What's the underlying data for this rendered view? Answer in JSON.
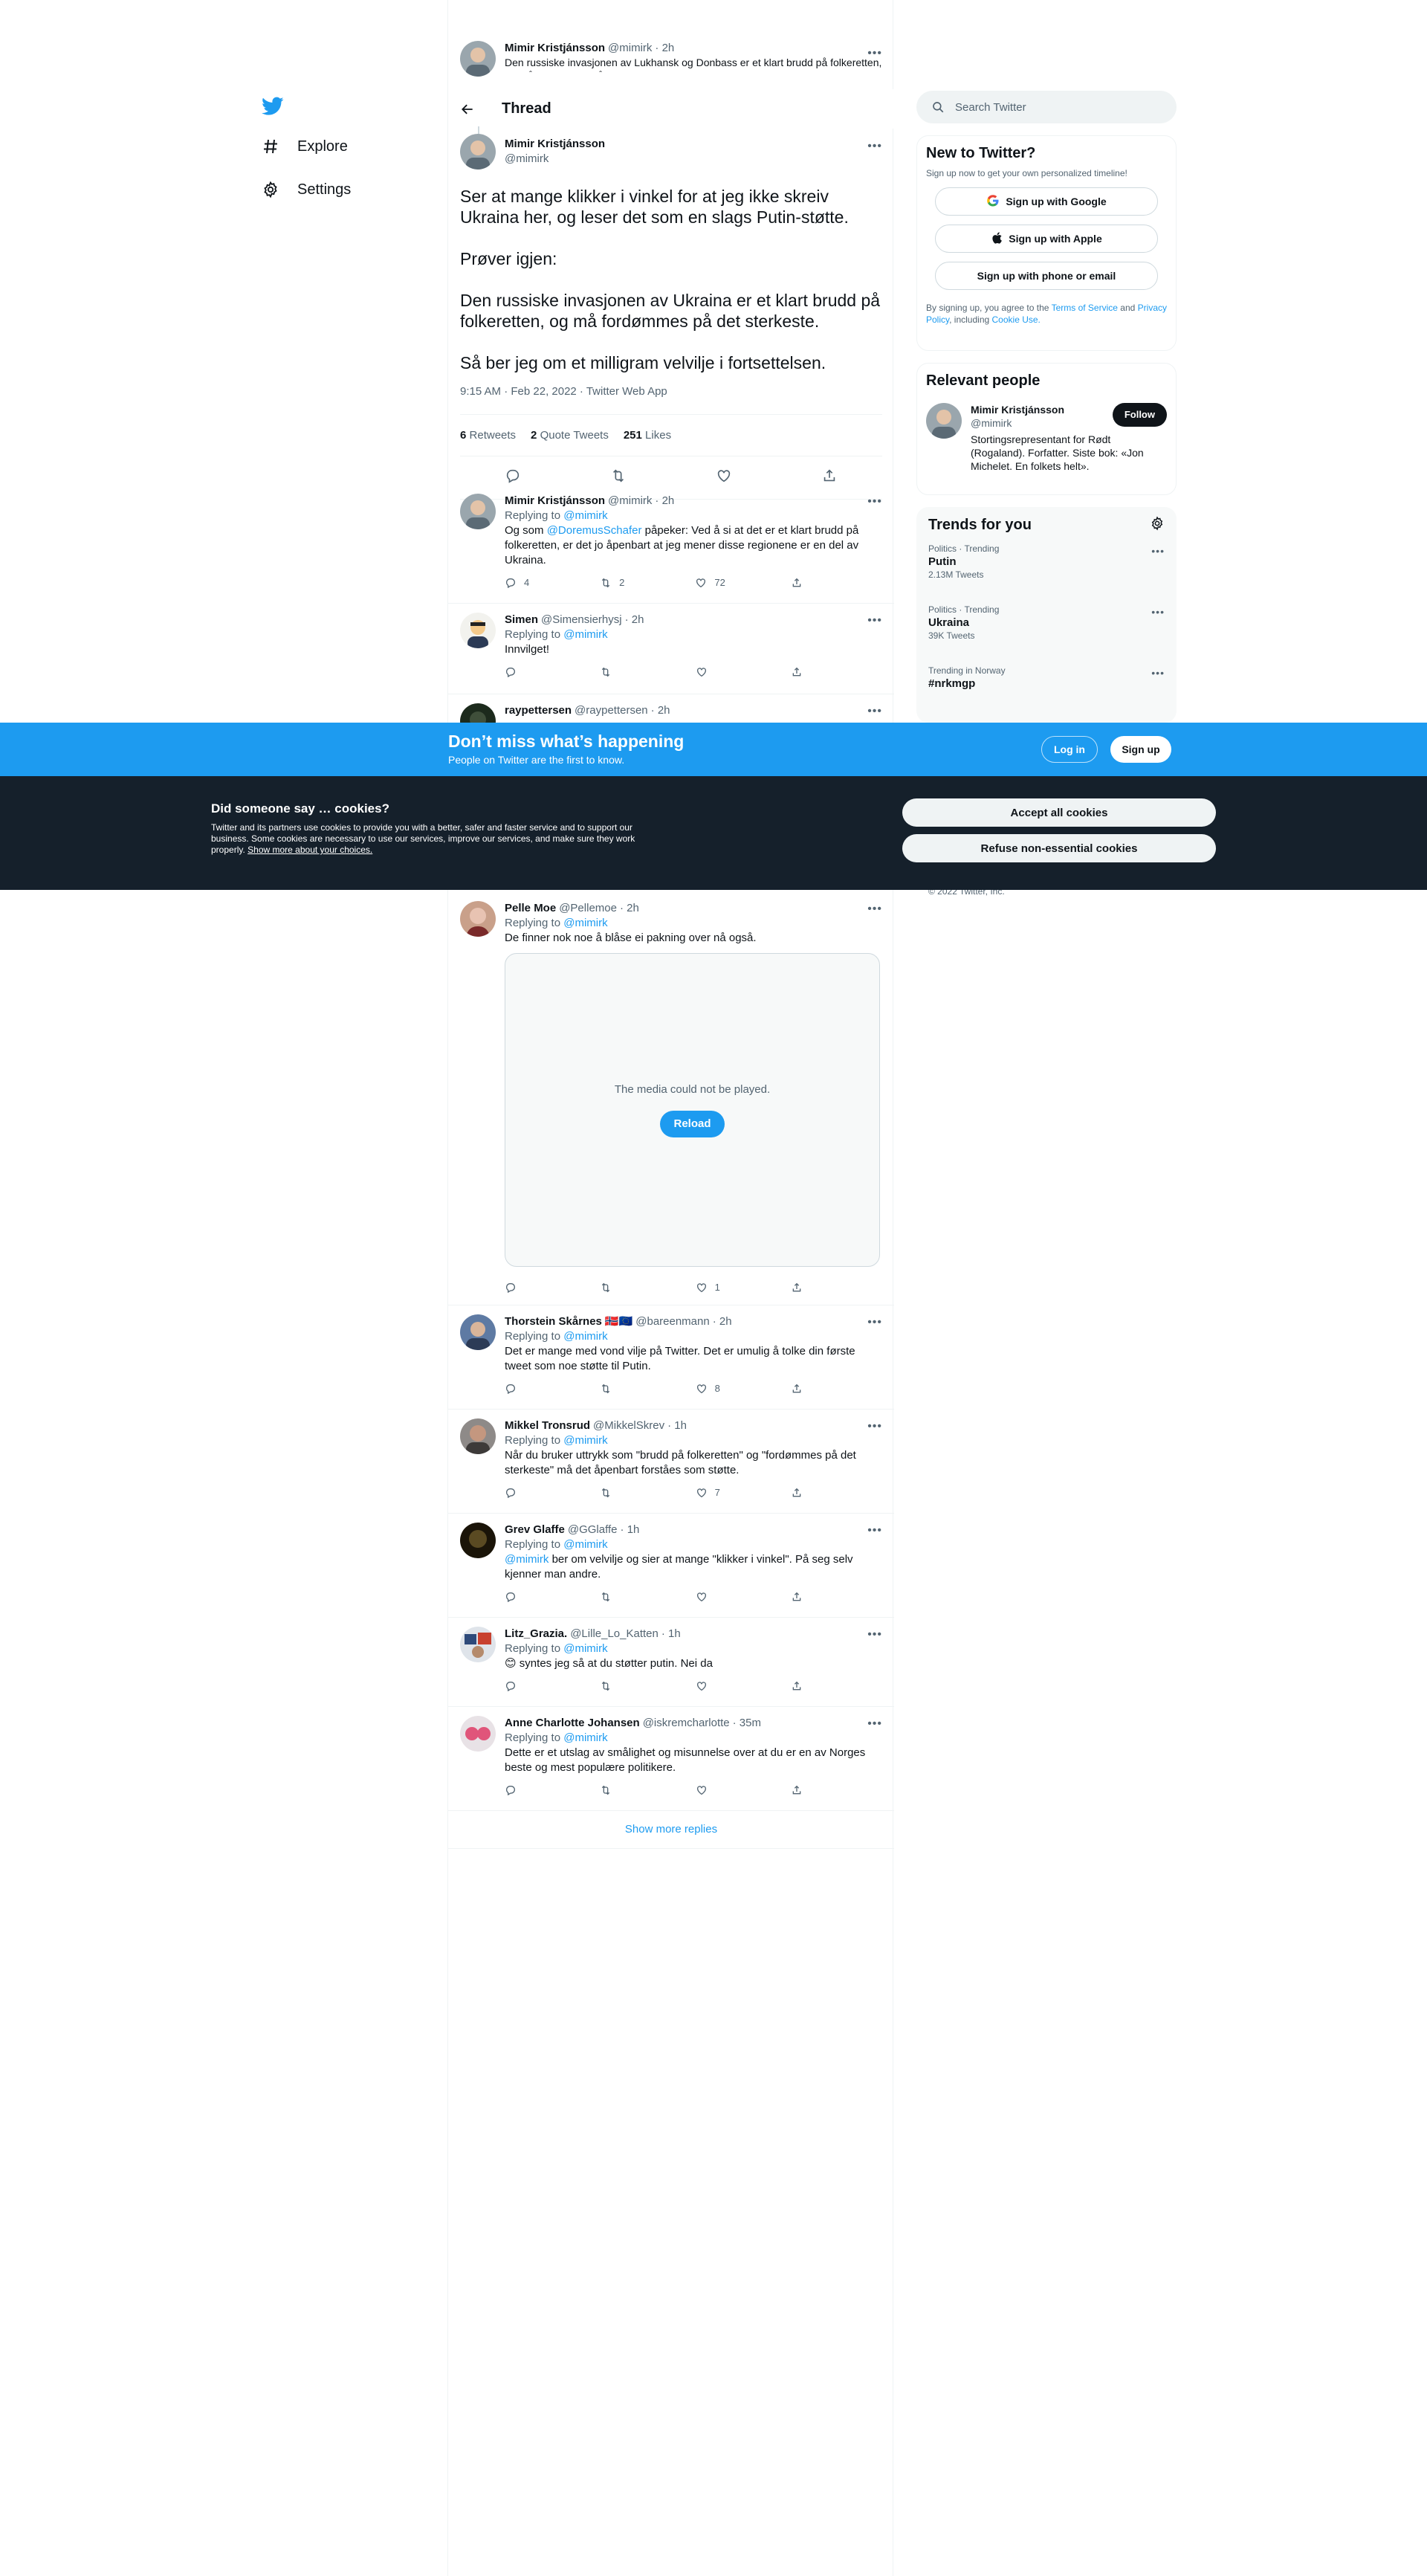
{
  "nav": {
    "items": [
      {
        "label": "Explore",
        "icon": "hash-icon"
      },
      {
        "label": "Settings",
        "icon": "gear-icon"
      }
    ]
  },
  "parent_tweet": {
    "name": "Mimir Kristjánsson",
    "handle": "@mimirk",
    "time": "· 2h",
    "text": "Den russiske invasjonen av Lukhansk og Donbass er et klart brudd på folkeretten, og må fordømmes på det sterkeste."
  },
  "header": {
    "title": "Thread"
  },
  "main_tweet": {
    "name": "Mimir Kristjánsson",
    "handle": "@mimirk",
    "text": "Ser at mange klikker i vinkel for at jeg ikke skreiv Ukraina her, og leser det som en slags Putin-støtte.\n\nPrøver igjen:\n\nDen russiske invasjonen av Ukraina er et klart brudd på folkeretten, og må fordømmes på det sterkeste.\n\nSå ber jeg om et milligram velvilje i fortsettelsen.",
    "meta": "9:15 AM · Feb 22, 2022 · Twitter Web App",
    "retweets": "6",
    "retweets_label": "Retweets",
    "quotes": "2",
    "quotes_label": "Quote Tweets",
    "likes": "251",
    "likes_label": "Likes"
  },
  "replies": [
    {
      "name": "Mimir Kristjánsson",
      "handle": "@mimirk",
      "time": "· 2h",
      "replying_prefix": "Replying to",
      "replying_to": "@mimirk",
      "mention": "Og som",
      "mention_user": "@DoremusSchafer",
      "text": "påpeker: Ved å si at det er et klart brudd på folkeretten, er det jo åpenbart at jeg mener disse regionene er en del av Ukraina.",
      "reply_count": "4",
      "retweet_count": "2",
      "like_count": "72"
    },
    {
      "name": "Simen",
      "handle": "@Simensierhysj",
      "time": "· 2h",
      "replying_prefix": "Replying to",
      "replying_to": "@mimirk",
      "text": "Innvilget!",
      "reply_count": "",
      "retweet_count": "",
      "like_count": ""
    },
    {
      "name": "raypettersen",
      "handle": "@raypettersen",
      "time": "· 2h"
    },
    {
      "name": "Pelle Moe",
      "handle": "@Pellemoe",
      "time": "· 2h",
      "replying_prefix": "Replying to",
      "replying_to": "@mimirk",
      "text": "De finner nok noe å blåse ei pakning over nå også.",
      "media_message": "The media could not be played.",
      "media_button": "Reload",
      "reply_count": "",
      "retweet_count": "",
      "like_count": "1"
    },
    {
      "name": "Thorstein Skårnes",
      "flags": "🇳🇴🇪🇺",
      "handle": "@bareenmann",
      "time": "· 2h",
      "replying_prefix": "Replying to",
      "replying_to": "@mimirk",
      "text": "Det er mange med vond vilje på Twitter. Det er umulig å tolke din første tweet som noe støtte til Putin.",
      "reply_count": "",
      "retweet_count": "",
      "like_count": "8"
    },
    {
      "name": "Mikkel Tronsrud",
      "handle": "@MikkelSkrev",
      "time": "· 1h",
      "replying_prefix": "Replying to",
      "replying_to": "@mimirk",
      "text": "Når du bruker uttrykk som \"brudd på folkeretten\" og \"fordømmes på det sterkeste\" må det åpenbart forståes som støtte.",
      "reply_count": "",
      "retweet_count": "",
      "like_count": "7"
    },
    {
      "name": "Grev Glaffe",
      "handle": "@GGlaffe",
      "time": "· 1h",
      "replying_prefix": "Replying to",
      "replying_to": "@mimirk",
      "mention_user": "@mimirk",
      "text": "ber om velvilje og sier at mange \"klikker i vinkel\". På seg selv kjenner man andre.",
      "reply_count": "",
      "retweet_count": "",
      "like_count": ""
    },
    {
      "name": "Litz_Grazia.",
      "handle": "@Lille_Lo_Katten",
      "time": "· 1h",
      "replying_prefix": "Replying to",
      "replying_to": "@mimirk",
      "text": "😊 syntes jeg så at du støtter putin. Nei da",
      "reply_count": "",
      "retweet_count": "",
      "like_count": ""
    },
    {
      "name": "Anne Charlotte Johansen",
      "handle": "@iskremcharlotte",
      "time": "· 35m",
      "replying_prefix": "Replying to",
      "replying_to": "@mimirk",
      "text": "Dette er et utslag av smålighet og misunnelse over at du er en av Norges beste og mest populære politikere.",
      "reply_count": "",
      "retweet_count": "",
      "like_count": ""
    }
  ],
  "show_more": "Show more replies",
  "search": {
    "placeholder": "Search Twitter"
  },
  "new_to_twitter": {
    "title": "New to Twitter?",
    "subtitle": "Sign up now to get your own personalized timeline!",
    "google": "Sign up with Google",
    "apple": "Sign up with Apple",
    "phone": "Sign up with phone or email",
    "legal_1": "By signing up, you agree to the",
    "terms": "Terms of Service",
    "legal_2": "and",
    "privacy": "Privacy Policy",
    "legal_3": ", including",
    "cookie_use": "Cookie Use."
  },
  "relevant_people": {
    "title": "Relevant people",
    "name": "Mimir Kristjánsson",
    "handle": "@mimirk",
    "bio": "Stortingsrepresentant for Rødt (Rogaland). Forfatter. Siste bok: «Jon Michelet. En folkets helt».",
    "follow": "Follow"
  },
  "trends": {
    "title": "Trends for you",
    "items": [
      {
        "context": "Politics · Trending",
        "name": "Putin",
        "count": "2.13M Tweets"
      },
      {
        "context": "Politics · Trending",
        "name": "Ukraina",
        "count": "39K Tweets"
      },
      {
        "context": "Trending in Norway",
        "name": "#nrkmgp",
        "count": ""
      }
    ]
  },
  "copyright": "© 2022 Twitter, Inc.",
  "banner": {
    "title": "Don’t miss what’s happening",
    "subtitle": "People on Twitter are the first to know.",
    "login": "Log in",
    "signup": "Sign up"
  },
  "cookies": {
    "title": "Did someone say … cookies?",
    "text": "Twitter and its partners use cookies to provide you with a better, safer and faster service and to support our business. Some cookies are necessary to use our services, improve our services, and make sure they work properly.",
    "link": "Show more about your choices.",
    "accept": "Accept all cookies",
    "refuse": "Refuse non-essential cookies"
  },
  "colors": {
    "accent": "#1d9bf0",
    "text": "#0f1419",
    "muted": "#536471",
    "banner": "#1d9bf0",
    "cookie_bg": "#15202b"
  }
}
